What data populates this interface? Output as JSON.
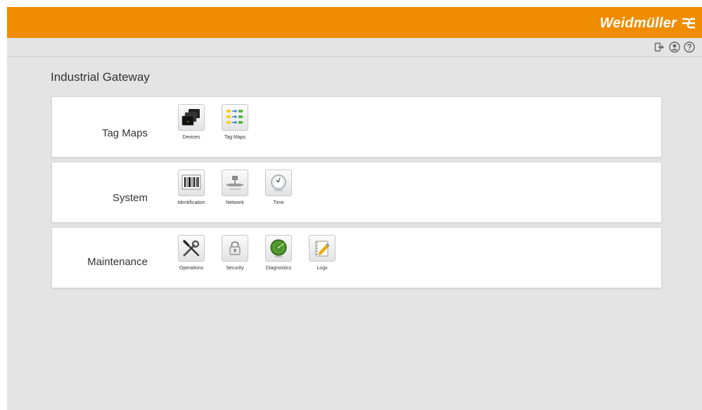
{
  "header": {
    "brand": "Weidmüller",
    "brand_color": "#f08c00"
  },
  "toolbar": {
    "icons": [
      "logout-icon",
      "user-icon",
      "help-icon"
    ]
  },
  "page": {
    "title": "Industrial Gateway"
  },
  "panels": [
    {
      "label": "Tag Maps",
      "tiles": [
        {
          "label": "Devices",
          "icon": "devices-icon"
        },
        {
          "label": "Tag Maps",
          "icon": "tag-maps-icon"
        }
      ]
    },
    {
      "label": "System",
      "tiles": [
        {
          "label": "Identification",
          "icon": "barcode-icon"
        },
        {
          "label": "Network",
          "icon": "network-icon"
        },
        {
          "label": "Time",
          "icon": "clock-icon"
        }
      ]
    },
    {
      "label": "Maintenance",
      "tiles": [
        {
          "label": "Operations",
          "icon": "wrench-screwdriver-icon"
        },
        {
          "label": "Security",
          "icon": "lock-icon"
        },
        {
          "label": "Diagnostics",
          "icon": "radar-icon"
        },
        {
          "label": "Logs",
          "icon": "notepad-icon"
        }
      ]
    }
  ]
}
